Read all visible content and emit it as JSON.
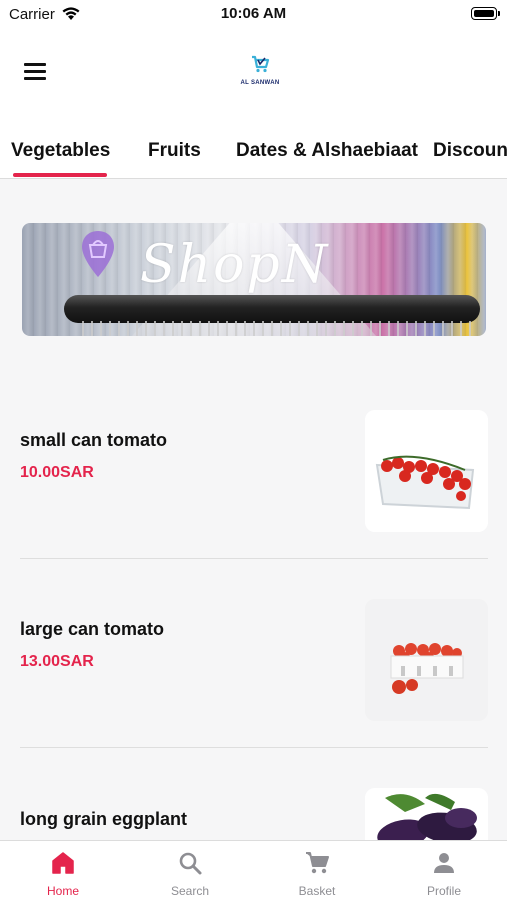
{
  "status_bar": {
    "carrier": "Carrier",
    "time": "10:06 AM"
  },
  "header": {
    "logo_text": "AL SANWAN"
  },
  "category_tabs": [
    {
      "label": "Vegetables",
      "active": true
    },
    {
      "label": "Fruits",
      "active": false
    },
    {
      "label": "Dates & Alshaebiaat",
      "active": false
    },
    {
      "label": "Discount",
      "active": false
    }
  ],
  "banner": {
    "script_text": "ShopN"
  },
  "products": [
    {
      "name": "small can tomato",
      "price": "10.00SAR",
      "image_icon": "cherry-tomatoes-in-tray"
    },
    {
      "name": "large can tomato",
      "price": "13.00SAR",
      "image_icon": "tomatoes-in-crate"
    },
    {
      "name": "long grain eggplant",
      "price": "",
      "image_icon": "eggplants"
    }
  ],
  "bottom_nav": [
    {
      "label": "Home",
      "icon": "home-icon",
      "active": true
    },
    {
      "label": "Search",
      "icon": "search-icon",
      "active": false
    },
    {
      "label": "Basket",
      "icon": "cart-icon",
      "active": false
    },
    {
      "label": "Profile",
      "icon": "person-icon",
      "active": false
    }
  ],
  "colors": {
    "accent": "#e4244c",
    "inactive": "#8e8e93",
    "background": "#f6f6f7"
  }
}
